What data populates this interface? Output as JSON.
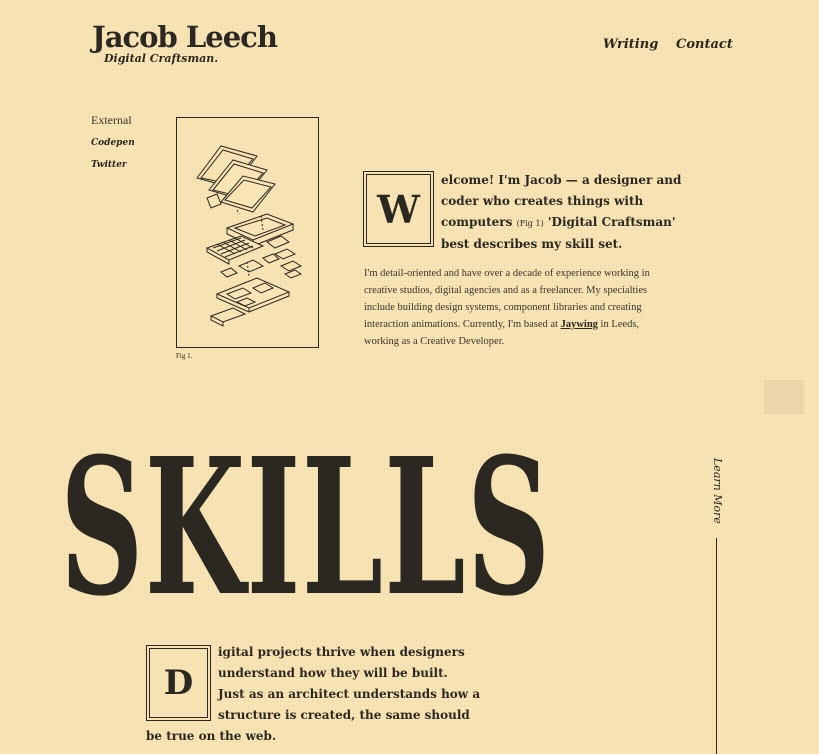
{
  "header": {
    "brand_name": "Jacob Leech",
    "brand_tagline": "Digital Craftsman.",
    "nav": [
      {
        "label": "Writing"
      },
      {
        "label": "Contact"
      }
    ]
  },
  "external": {
    "heading": "External",
    "links": [
      {
        "label": "Codepen"
      },
      {
        "label": "Twitter"
      }
    ]
  },
  "figure": {
    "caption": "Fig 1."
  },
  "intro": {
    "dropcap": "W",
    "lead": {
      "line1": "elcome! I'm Jacob — a designer and",
      "line2": "coder who creates things with",
      "line3_pre": "computers",
      "line3_ref": "(Fig 1)",
      "line3_post": "'Digital Craftsman'",
      "line4": "best describes my skill set."
    },
    "body": {
      "line1": "I'm detail-oriented and have over a decade of experience working in",
      "line2": "creative studios, digital agencies and as a freelancer. My specialties",
      "line3": "include building design systems, component libraries and creating",
      "line4_pre": "interaction animations. Currently, I'm based at",
      "line4_link": "Jaywing",
      "line4_post": "in Leeds,",
      "line5": "working as a Creative Developer."
    }
  },
  "skills": {
    "heading": "SKILLS",
    "learn_more": "Learn More",
    "dropcap": "D",
    "lead": {
      "line1": "igital projects thrive when designers",
      "line2": "understand how they will be built.",
      "line3": "Just as an architect understands how a",
      "line4": "structure is created, the same should",
      "line5": "be true on the web."
    }
  },
  "colors": {
    "background": "#f8e4b4",
    "ink": "#2b2721"
  }
}
